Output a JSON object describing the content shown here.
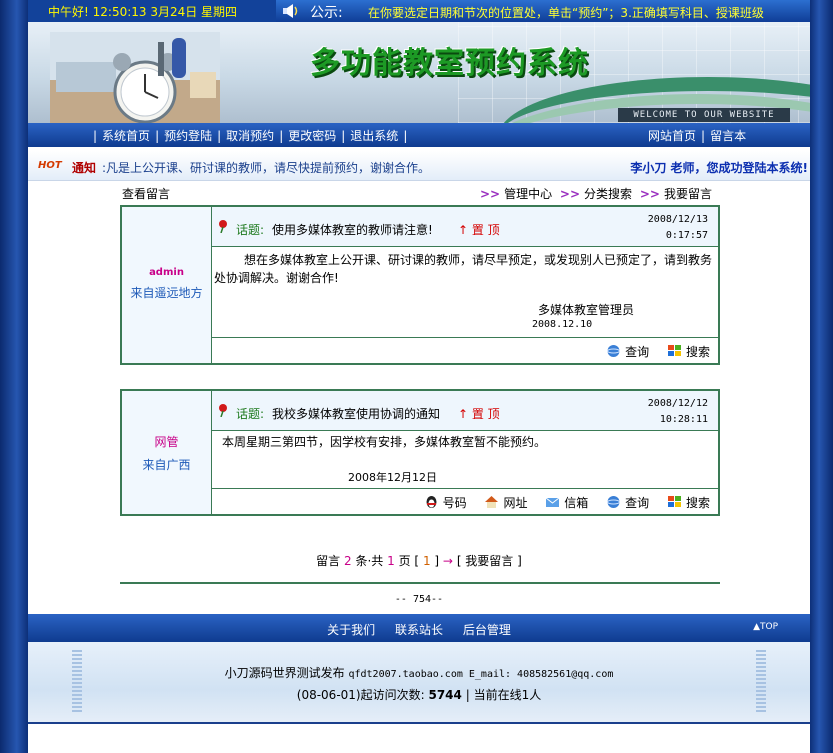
{
  "topbar": {
    "clock": "中午好! 12:50:13 3月24日 星期四",
    "notice_label": "公示:",
    "notice_text": "在你要选定日期和节次的位置处，单击“预约”；3.正确填写科目、授课班级"
  },
  "banner": {
    "title": "多功能教室预约系统",
    "welcome": "WELCOME TO OUR WEBSITE"
  },
  "nav": {
    "items": [
      "系统首页",
      "预约登陆",
      "取消预约",
      "更改密码",
      "退出系统"
    ],
    "right_items": [
      "网站首页",
      "留言本"
    ]
  },
  "notice_bar": {
    "hot": "HOT",
    "label": "通知",
    "text": ":凡是上公开课、研讨课的教师，请尽快提前预约，谢谢合作。",
    "welcome": "李小刀 老师，您成功登陆本系统!"
  },
  "crumb": {
    "left": "查看留言",
    "links": [
      "管理中心",
      "分类搜索",
      "我要留言"
    ]
  },
  "posts": [
    {
      "author_name": "admin",
      "author_from": "来自遥远地方",
      "topic_label": "话题:",
      "topic": "使用多媒体教室的教师请注意!",
      "pin": "↑ 置 顶",
      "date": "2008/12/13",
      "time": "0:17:57",
      "content": "想在多媒体教室上公开课、研讨课的教师，请尽早预定，或发现别人已预定了，请到教务处协调解决。谢谢合作!",
      "signature": "多媒体教室管理员",
      "sign_date": "2008.12.10",
      "tools": [
        "查询",
        "搜索"
      ]
    },
    {
      "author_name": "网管",
      "author_from": "来自广西",
      "topic_label": "话题:",
      "topic": "我校多媒体教室使用协调的通知",
      "pin": "↑ 置 顶",
      "date": "2008/12/12",
      "time": "10:28:11",
      "content": "本周星期三第四节，因学校有安排，多媒体教室暂不能预约。",
      "sign_date": "2008年12月12日",
      "tools": [
        "号码",
        "网址",
        "信箱",
        "查询",
        "搜索"
      ]
    }
  ],
  "pager": {
    "prefix": "留言",
    "count": "2",
    "mid": "条·共",
    "pages": "1",
    "suffix": "页 [",
    "current": "1",
    "after": "]",
    "arrow": "→",
    "post_link": "[ 我要留言 ]"
  },
  "counter": "-- 754--",
  "footer_nav": {
    "links": [
      "关于我们",
      "联系站长",
      "后台管理"
    ],
    "top": "▲TOP"
  },
  "footer": {
    "line1_a": "小刀源码世界测试发布",
    "line1_b": "qfdt2007.taobao.com E_mail: 408582561@qq.com",
    "line2_a": "(08-06-01)起访问次数:",
    "visits": "5744",
    "line2_b": "| 当前在线1人"
  },
  "colors": {
    "page_bg": "#1a3f8c",
    "nav_bg": "#1c4fae",
    "card_border": "#3a7a55",
    "title_green": "#1d9a25",
    "topic_green": "#1e7a1e",
    "pin_red": "#d40000"
  }
}
